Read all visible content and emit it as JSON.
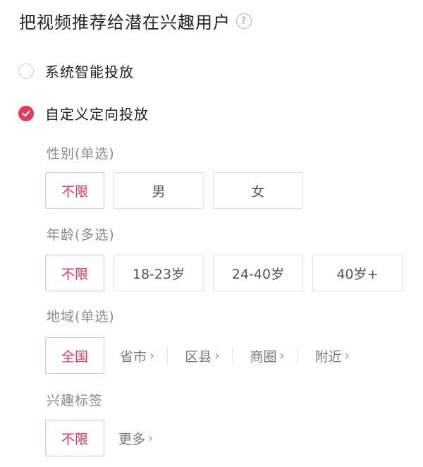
{
  "header": {
    "title": "把视频推荐给潜在兴趣用户",
    "help_icon": "question-circle-icon"
  },
  "options": [
    {
      "label": "系统智能投放",
      "checked": false
    },
    {
      "label": "自定义定向投放",
      "checked": true
    }
  ],
  "gender": {
    "label": "性别(单选)",
    "chips": [
      "不限",
      "男",
      "女"
    ],
    "selected": "不限"
  },
  "age": {
    "label": "年龄(多选)",
    "chips": [
      "不限",
      "18-23岁",
      "24-40岁",
      "40岁+"
    ],
    "selected": "不限"
  },
  "region": {
    "label": "地域(单选)",
    "selected_chip": "全国",
    "links": [
      "省市",
      "区县",
      "商圈",
      "附近"
    ]
  },
  "interest": {
    "label": "兴趣标签",
    "selected_chip": "不限",
    "more": "更多"
  },
  "colors": {
    "accent": "#e5395b",
    "selected_border": "#f0c3cc",
    "label_gray": "#8a8a8a"
  }
}
